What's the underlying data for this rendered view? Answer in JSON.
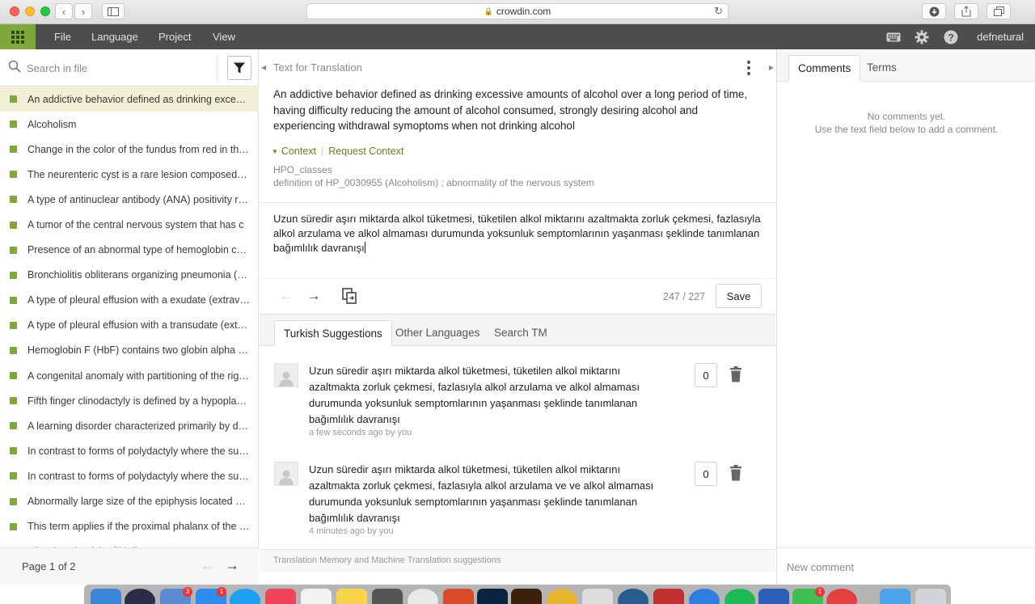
{
  "browser": {
    "url": "crowdin.com"
  },
  "appbar": {
    "menu": [
      "File",
      "Language",
      "Project",
      "View"
    ],
    "username": "defnetural"
  },
  "left": {
    "search_placeholder": "Search in file",
    "strings": [
      "An addictive behavior defined as drinking excessive amounts of alcohol over a long period of time",
      "Alcoholism",
      "Change in the color of the fundus from red in the normal state",
      "The neurenteric cyst is a rare lesion composed of enteric epithelium",
      "A type of antinuclear antibody (ANA) positivity revealed",
      "A tumor of the central nervous system that has c",
      "Presence of an abnormal type of hemoglobin characterized",
      "Bronchiolitis obliterans organizing pneumonia (BOOP)",
      "A type of pleural effusion with a exudate (extravascular fluid)",
      "A type of pleural effusion with a transudate (extravascular fluid)",
      "Hemoglobin F (HbF) contains two globin alpha chains",
      "A congenital anomaly with partitioning of the right atrium",
      "Fifth finger clinodactyly is defined by a hypoplastic middle phalanx",
      "A learning disorder characterized primarily by difficulties",
      "In contrast to forms of polydactyly where the supernumerary digit",
      "In contrast to forms of polydactyly where the supernumerary digit",
      "Abnormally large size of the epiphysis located at the end",
      "This term applies if the proximal phalanx of the thumb",
      "Clinodactyly of the fifth finger"
    ],
    "active_index": 0,
    "page_label": "Page 1 of 2"
  },
  "center": {
    "title": "Text for Translation",
    "source_text": "An addictive behavior defined as drinking excessive amounts of alcohol over a long period of time, having difficulty reducing the amount of alcohol consumed, strongly desiring alcohol and experiencing withdrawal symoptoms when not drinking alcohol",
    "context_label": "Context",
    "request_context_label": "Request Context",
    "context_file": "HPO_classes",
    "context_desc": "definition of HP_0030955 (Alcoholism) ; abnormality of the nervous system",
    "translation_text": "Uzun süredir aşırı miktarda alkol tüketmesi, tüketilen alkol miktarını azaltmakta zorluk çekmesi, fazlasıyla alkol arzulama ve alkol almaması durumunda yoksunluk semptomlarının yaşanması şeklinde tanımlanan bağımlılık davranışı",
    "counter": "247 / 227",
    "save_label": "Save",
    "tabs": [
      "Turkish Suggestions",
      "Other Languages",
      "Search TM"
    ],
    "suggestions": [
      {
        "text": "Uzun süredir aşırı miktarda alkol tüketmesi, tüketilen alkol miktarını azaltmakta zorluk çekmesi, fazlasıyla alkol arzulama ve alkol almaması durumunda yoksunluk semptomlarının yaşanması şeklinde tanımlanan bağımlılık davranışı",
        "meta": "a few seconds ago by you",
        "votes": "0"
      },
      {
        "text": "Uzun süredir aşırı miktarda alkol tüketmesi, tüketilen alkol miktarını azaltmakta zorluk çekmesi, fazlasıyla alkol arzulama ve ve alkol almaması durumunda yoksunluk semptomlarının yaşanması şeklinde tanımlanan bağımlılık davranışı",
        "meta": "4 minutes ago by you",
        "votes": "0"
      }
    ],
    "tm_footer": "Translation Memory and Machine Translation suggestions"
  },
  "right": {
    "tabs": [
      "Comments",
      "Terms"
    ],
    "no_comments_line1": "No comments yet.",
    "no_comments_line2": "Use the text field below to add a comment.",
    "new_comment_placeholder": "New comment"
  },
  "dock": {
    "badges": [
      "3",
      "1",
      "1"
    ]
  },
  "colors": {
    "accent": "#7fa83b",
    "appbar": "#4d4d4d",
    "context_link": "#6b7b1e",
    "active_row": "#f3efd6"
  }
}
